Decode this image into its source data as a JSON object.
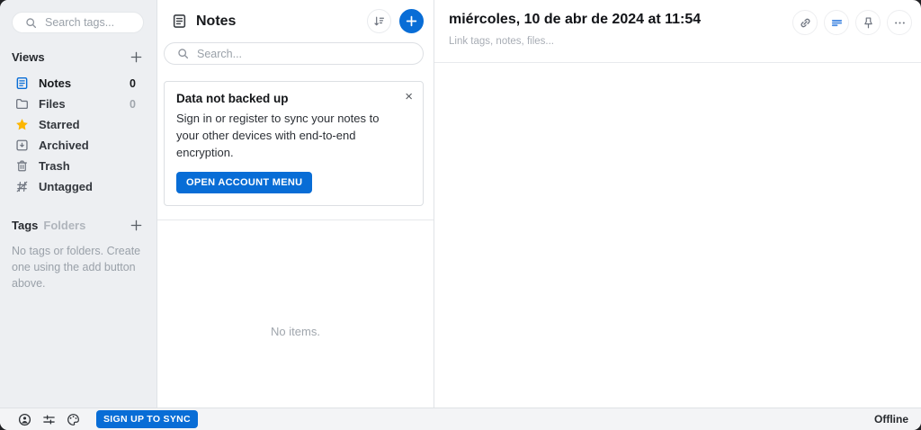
{
  "colors": {
    "accent": "#086dd6",
    "star": "#fcb603"
  },
  "sidebar": {
    "search_placeholder": "Search tags...",
    "views_header": "Views",
    "items": [
      {
        "label": "Notes",
        "count": "0",
        "icon": "notes-document-icon",
        "selected": true
      },
      {
        "label": "Files",
        "count": "0",
        "icon": "folder-icon"
      },
      {
        "label": "Starred",
        "icon": "star-icon"
      },
      {
        "label": "Archived",
        "icon": "archive-icon"
      },
      {
        "label": "Trash",
        "icon": "trash-icon"
      },
      {
        "label": "Untagged",
        "icon": "hash-slash-icon"
      }
    ],
    "tags_header": "Tags",
    "folders_header": "Folders",
    "empty_text": "No tags or folders. Create one using the add button above."
  },
  "notes_panel": {
    "title": "Notes",
    "search_placeholder": "Search...",
    "banner": {
      "title": "Data not backed up",
      "body": "Sign in or register to sync your notes to your other devices with end-to-end encryption.",
      "button_label": "OPEN ACCOUNT MENU",
      "close_glyph": "×"
    },
    "empty_text": "No items."
  },
  "editor": {
    "title": "miércoles, 10 de abr de 2024 at 11:54",
    "link_bar_placeholder": "Link tags, notes, files..."
  },
  "footer": {
    "signup_label": "SIGN UP TO SYNC",
    "status": "Offline"
  },
  "icons": {
    "search": "magnifier",
    "add": "plus",
    "sort": "sort-descending",
    "note_header": "document",
    "link": "chain",
    "note_type": "text-lines",
    "pin": "pushpin",
    "more": "ellipsis",
    "account": "person-circle",
    "preferences": "sliders",
    "themes": "palette",
    "close": "x"
  }
}
